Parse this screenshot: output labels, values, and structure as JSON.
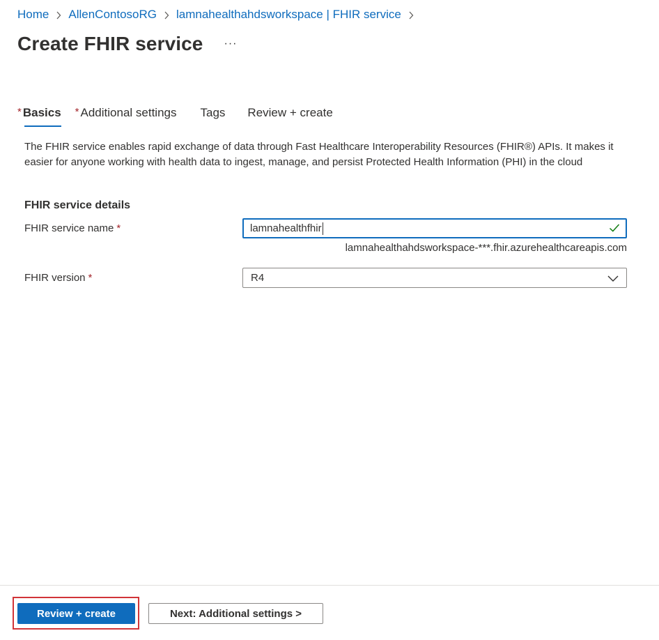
{
  "breadcrumb": {
    "items": [
      "Home",
      "AllenContosoRG",
      "lamnahealthahdsworkspace | FHIR service"
    ]
  },
  "header": {
    "title": "Create FHIR service",
    "more": "···"
  },
  "tabs": [
    {
      "label": "Basics",
      "required": "*",
      "active": true
    },
    {
      "label": "Additional settings",
      "required": "*",
      "active": false
    },
    {
      "label": "Tags",
      "required": "",
      "active": false
    },
    {
      "label": "Review + create",
      "required": "",
      "active": false
    }
  ],
  "description": "The FHIR service enables rapid exchange of data through Fast Healthcare Interoperability Resources (FHIR®) APIs. It makes it easier for anyone working with health data to ingest, manage, and persist Protected Health Information (PHI) in the cloud",
  "details": {
    "section_title": "FHIR service details",
    "name_field": {
      "label": "FHIR service name",
      "required": "*",
      "value": "lamnahealthfhir",
      "helper": "lamnahealthahdsworkspace-***.fhir.azurehealthcareapis.com",
      "valid_icon": "checkmark-icon"
    },
    "version_field": {
      "label": "FHIR version",
      "required": "*",
      "value": "R4"
    }
  },
  "footer": {
    "primary_label": "Review + create",
    "secondary_label": "Next: Additional settings >"
  },
  "colors": {
    "accent": "#0f6cbd",
    "required": "#a4262c",
    "highlight": "#d13438",
    "valid": "#107c10"
  }
}
